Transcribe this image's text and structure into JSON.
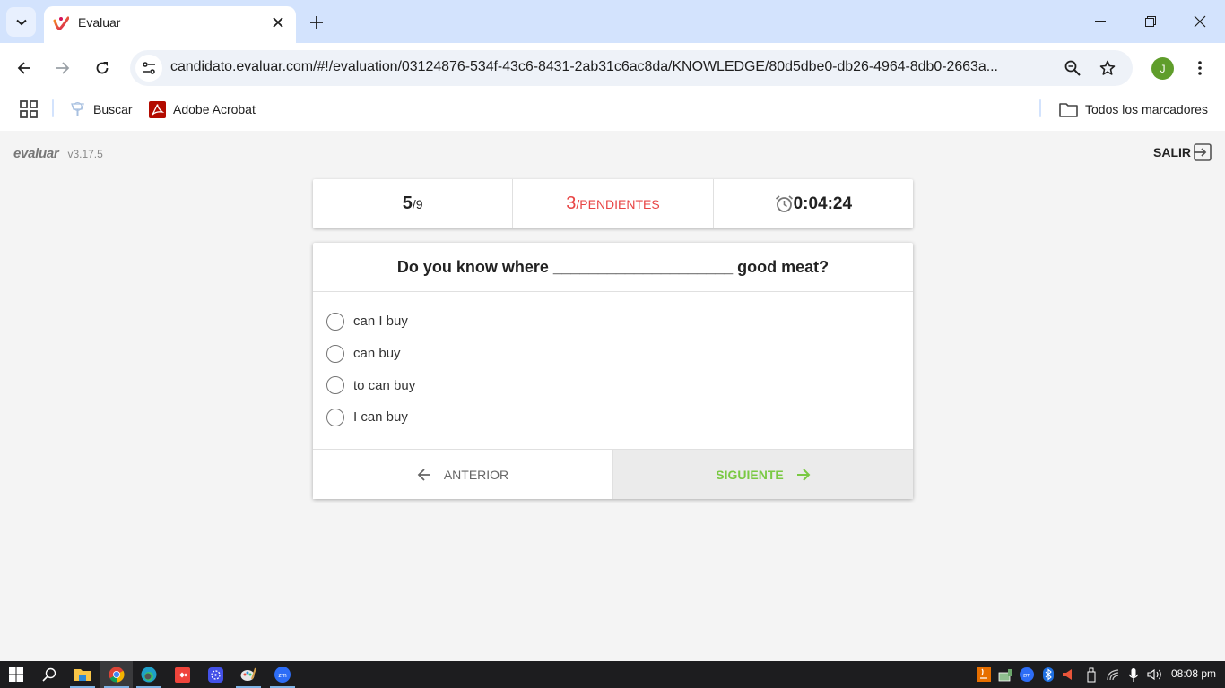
{
  "browser": {
    "tab_title": "Evaluar",
    "url": "candidato.evaluar.com/#!/evaluation/03124876-534f-43c6-8431-2ab31c6ac8da/KNOWLEDGE/80d5dbe0-db26-4964-8db0-2663a...",
    "avatar_initial": "J",
    "bookmarks": [
      {
        "label": "Buscar",
        "icon": "search-bookmark-icon"
      },
      {
        "label": "Adobe Acrobat",
        "icon": "adobe-acrobat-icon"
      }
    ],
    "all_bookmarks_label": "Todos los marcadores"
  },
  "app": {
    "brand": "evaluar",
    "version": "v3.17.5",
    "logout_label": "SALIR"
  },
  "status": {
    "current": "5",
    "total": "/9",
    "pending_count": "3",
    "pending_label": "/PENDIENTES",
    "timer": "0:04:24"
  },
  "question": {
    "text": "Do you know where ____________________ good meat?",
    "options": [
      {
        "label": "can I buy",
        "selected": false
      },
      {
        "label": "can buy",
        "selected": false
      },
      {
        "label": "to can buy",
        "selected": false
      },
      {
        "label": "I can buy",
        "selected": false
      }
    ]
  },
  "navigation": {
    "prev_label": "ANTERIOR",
    "next_label": "SIGUIENTE"
  },
  "colors": {
    "accent_green": "#7ac943",
    "pending_red": "#e84545"
  },
  "taskbar": {
    "apps": [
      "windows-start",
      "search",
      "file-explorer",
      "chrome",
      "edge",
      "anydesk",
      "app-launcher",
      "paint",
      "zoom"
    ],
    "clock": "08:08 pm"
  }
}
